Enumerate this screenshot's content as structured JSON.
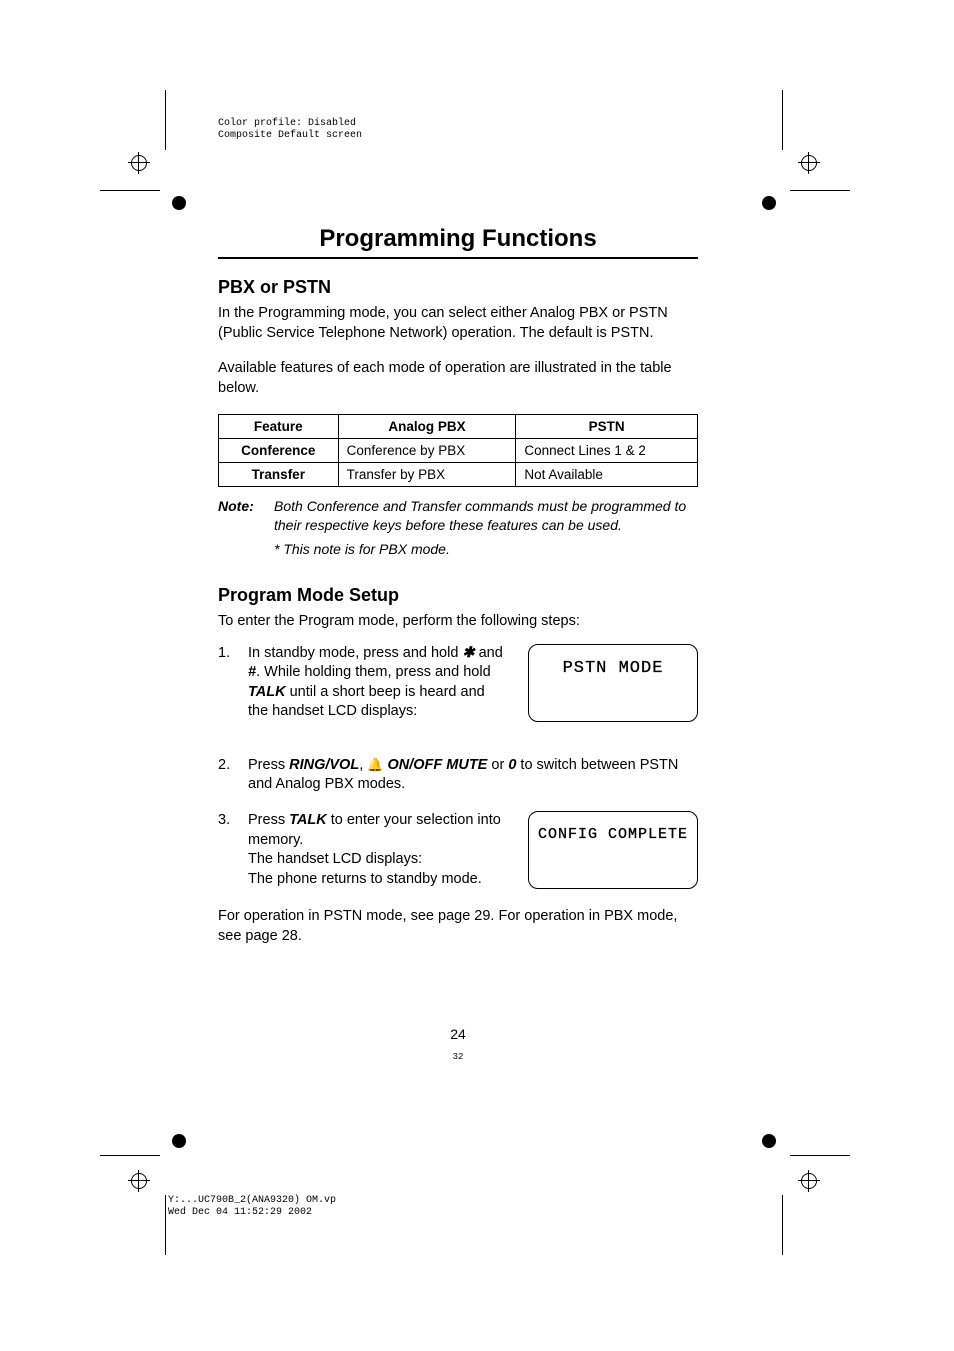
{
  "meta": {
    "profile_line1": "Color profile: Disabled",
    "profile_line2": "Composite  Default screen",
    "footer_line1": "Y:...UC790B_2(ANA9320) OM.vp",
    "footer_line2": "Wed Dec 04 11:52:29 2002"
  },
  "heading": "Programming Functions",
  "section1": {
    "title": "PBX or PSTN",
    "para1": "In the Programming mode, you can select either Analog PBX or PSTN (Public Service Telephone Network) operation. The default is PSTN.",
    "para2": "Available features of each mode of operation are illustrated in the table below."
  },
  "table": {
    "headers": [
      "Feature",
      "Analog PBX",
      "PSTN"
    ],
    "rows": [
      [
        "Conference",
        "Conference by PBX",
        "Connect Lines 1 & 2"
      ],
      [
        "Transfer",
        "Transfer by PBX",
        "Not Available"
      ]
    ]
  },
  "note": {
    "label": "Note:",
    "text": "Both Conference and Transfer commands must be programmed to their respective keys before these features can be used.",
    "sub": "* This note is for PBX mode."
  },
  "section2": {
    "title": "Program Mode Setup",
    "intro": "To enter the Program mode, perform the following steps:"
  },
  "steps": {
    "s1": {
      "num": "1.",
      "pre": "In standby mode, press and hold ",
      "sym1": "✱",
      "mid1": " and ",
      "sym2": "#",
      "mid2": ". While holding them, press and hold ",
      "talk": "TALK",
      "post": " until a short beep is heard and the handset LCD displays:"
    },
    "s2": {
      "num": "2.",
      "pre": "Press ",
      "ring": "RING/VOL",
      "comma": ", ",
      "bell": "🔔",
      "onoff": " ON/OFF MUTE",
      "or": " or ",
      "zero": "0",
      "post": " to switch between PSTN and Analog PBX modes."
    },
    "s3": {
      "num": "3.",
      "pre": "Press ",
      "talk": "TALK",
      "post": " to enter your selection into memory.",
      "line2": "The handset LCD displays:",
      "line3": "The phone returns to standby mode."
    }
  },
  "lcd1": "PSTN MODE",
  "lcd2": "CONFIG COMPLETE",
  "closing": "For operation in PSTN mode, see page 29. For operation in PBX mode, see page 28.",
  "pagenum": "24",
  "pagenum_small": "32"
}
